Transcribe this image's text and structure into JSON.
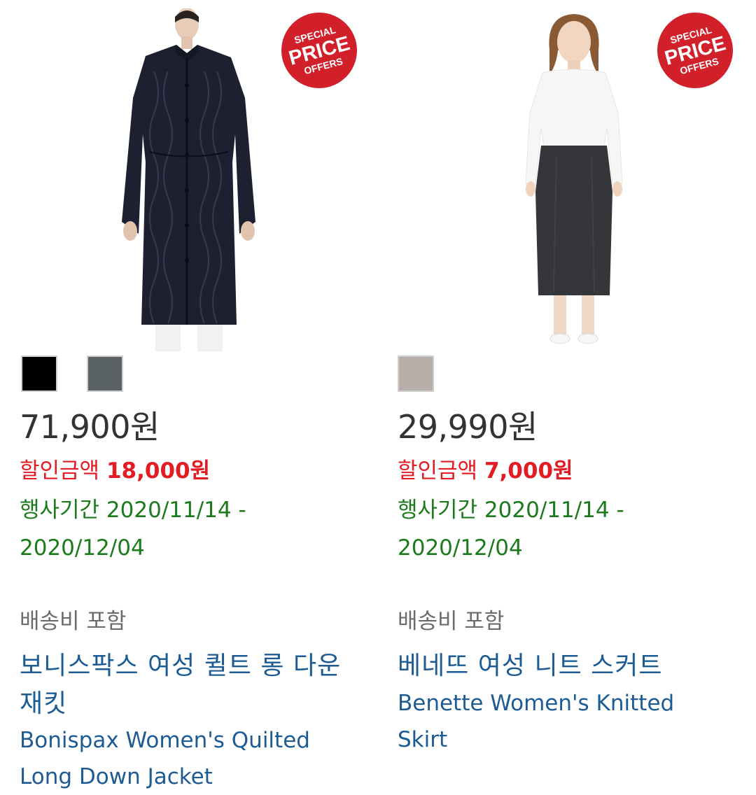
{
  "products": [
    {
      "image_alt": "Bonispax Women's Quilted Long Down Jacket",
      "badge": {
        "line1": "SPECIAL",
        "line2": "PRICE",
        "line3": "OFFERS"
      },
      "swatches": [
        {
          "color": "#000000"
        },
        {
          "color": "#5a6163"
        }
      ],
      "price": "71,900원",
      "discount_label": "할인금액",
      "discount_amount": "18,000원",
      "period": "행사기간 2020/11/14 - 2020/12/04",
      "shipping": "배송비 포함",
      "title_ko": "보니스팍스 여성 퀼트 롱 다운 재킷",
      "title_en": "Bonispax Women's Quilted Long Down Jacket"
    },
    {
      "image_alt": "Benette Women's Knitted Skirt",
      "badge": {
        "line1": "SPECIAL",
        "line2": "PRICE",
        "line3": "OFFERS"
      },
      "swatches": [
        {
          "color": "#b8aea9"
        }
      ],
      "price": "29,990원",
      "discount_label": "할인금액",
      "discount_amount": "7,000원",
      "period": "행사기간 2020/11/14 - 2020/12/04",
      "shipping": "배송비 포함",
      "title_ko": "베네뜨 여성 니트 스커트",
      "title_en": "Benette Women's Knitted Skirt"
    }
  ]
}
